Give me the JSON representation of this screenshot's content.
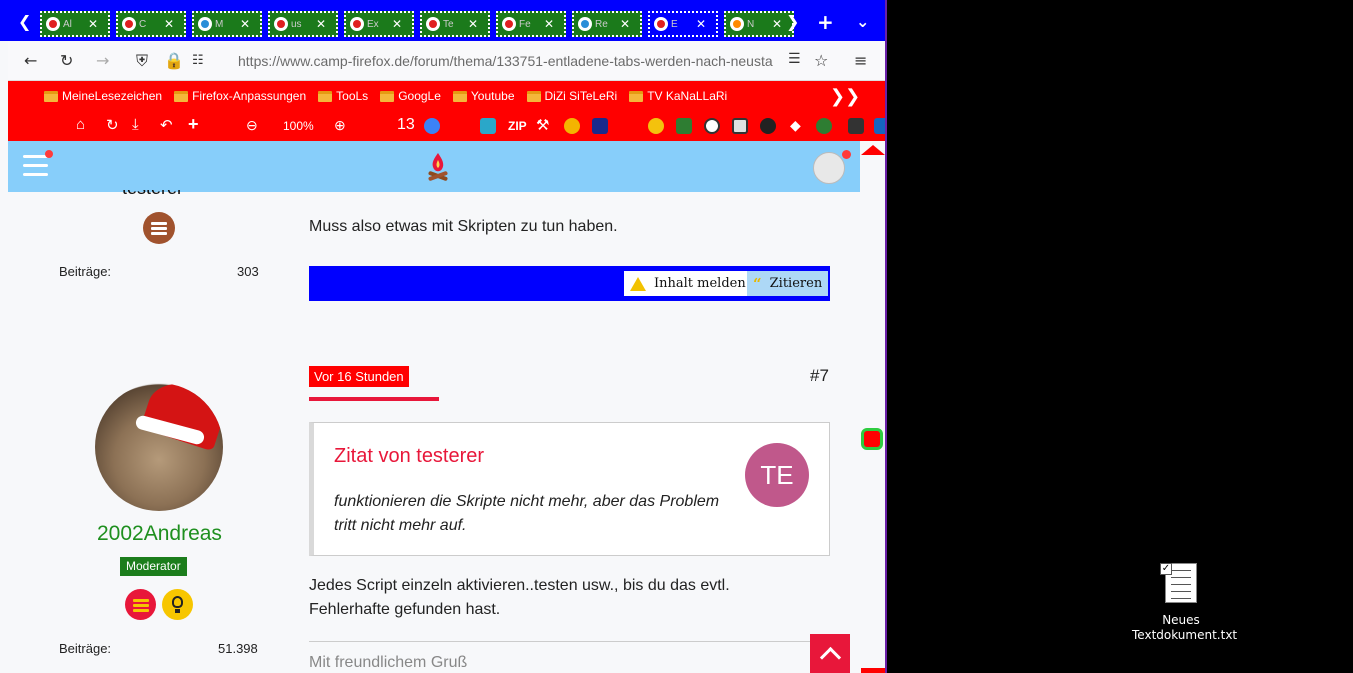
{
  "browser": {
    "tabs": [
      {
        "title": "Al",
        "icon": "page-icon"
      },
      {
        "title": "C",
        "icon": "page-icon"
      },
      {
        "title": "M",
        "icon": "globe-icon"
      },
      {
        "title": "us",
        "icon": "page-icon"
      },
      {
        "title": "Ex",
        "icon": "page-icon"
      },
      {
        "title": "Te",
        "icon": "page-icon"
      },
      {
        "title": "Fe",
        "icon": "page-icon"
      },
      {
        "title": "Re",
        "icon": "globe-icon"
      },
      {
        "title": "E",
        "icon": "page-icon"
      },
      {
        "title": "N",
        "icon": "firefox-icon"
      }
    ],
    "url": "https://www.camp-firefox.de/forum/thema/133751-entladene-tabs-werden-nach-neusta",
    "bookmarks": [
      "MeineLesezeichen",
      "Firefox-Anpassungen",
      "TooLs",
      "GoogLe",
      "Youtube",
      "DiZi SiTeLeRi",
      "TV KaNaLLaRi"
    ],
    "zoom": "100%",
    "toolbar_number": "13",
    "accent": "#0000ff",
    "bar_color": "#ff0000"
  },
  "forum": {
    "prev_post": {
      "author_partial": "testerer",
      "posts_label": "Beiträge:",
      "posts_count": "303",
      "text": "Muss also etwas mit Skripten zu tun haben.",
      "report_label": "Inhalt melden",
      "quote_label": "Zitieren"
    },
    "post": {
      "time": "Vor 16 Stunden",
      "number": "#7",
      "author": "2002Andreas",
      "role": "Moderator",
      "posts_label": "Beiträge:",
      "posts_count": "51.398",
      "quote_title": "Zitat von testerer",
      "quote_text": "funktionieren die Skripte nicht mehr, aber das Problem tritt nicht mehr auf.",
      "quote_avatar": "TE",
      "text": "Jedes Script einzeln aktivieren..testen usw., bis du das evtl. Fehlerhafte gefunden hast.",
      "signature": "Mit freundlichem Gruß"
    }
  },
  "desktop": {
    "icon_label": "Neues Textdokument.txt"
  }
}
